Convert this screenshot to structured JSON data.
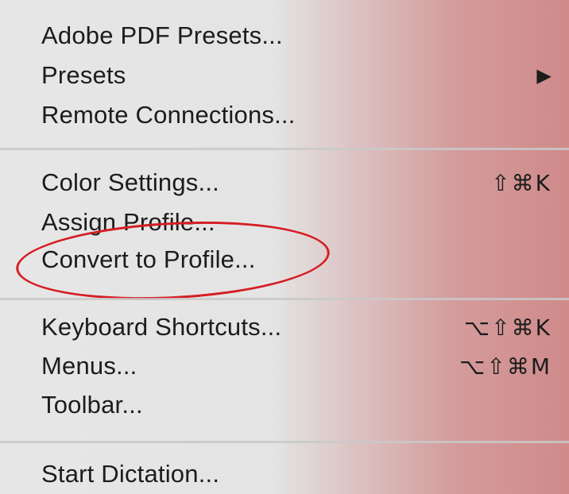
{
  "menu": {
    "items": [
      {
        "label": "Adobe PDF Presets...",
        "shortcut": ""
      },
      {
        "label": "Presets",
        "submenu_arrow": "▶"
      },
      {
        "label": "Remote Connections...",
        "shortcut": ""
      },
      {
        "label": "Color Settings...",
        "shortcut": "⇧⌘K"
      },
      {
        "label": "Assign Profile...",
        "shortcut": ""
      },
      {
        "label": "Convert to Profile...",
        "shortcut": ""
      },
      {
        "label": "Keyboard Shortcuts...",
        "shortcut": "⌥⇧⌘K"
      },
      {
        "label": "Menus...",
        "shortcut": "⌥⇧⌘M"
      },
      {
        "label": "Toolbar...",
        "shortcut": ""
      },
      {
        "label": "Start Dictation...",
        "shortcut": ""
      }
    ]
  },
  "annotation": {
    "highlighted_item": "Convert to Profile...",
    "color": "#d51d22"
  },
  "colors": {
    "text": "#1c1c1c",
    "separator": "#c9c9c9",
    "gradient_start": "#e6e6e6",
    "gradient_end": "#d08a8a"
  }
}
